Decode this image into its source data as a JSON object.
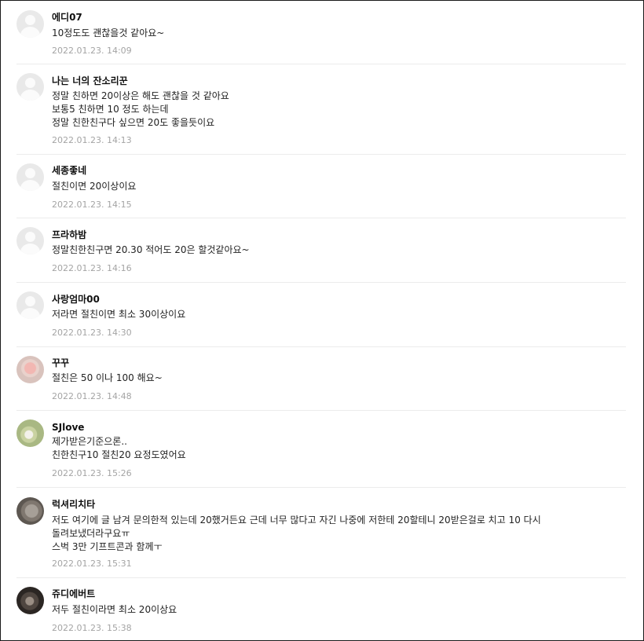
{
  "comments": [
    {
      "nickname": "에디07",
      "text": "10정도도 괜찮을것 같아요~",
      "date": "2022.01.23. 14:09",
      "avatar": "default-profile-icon"
    },
    {
      "nickname": "나는 너의 잔소리꾼",
      "text": "정말 친하면 20이상은 해도 괜찮을 것 같아요\n보통5 친하면 10 정도 하는데\n정말 친한친구다 싶으면 20도 좋을듯이요",
      "date": "2022.01.23. 14:13",
      "avatar": "default-profile-icon"
    },
    {
      "nickname": "세종좋네",
      "text": "절친이면 20이상이요",
      "date": "2022.01.23. 14:15",
      "avatar": "default-profile-icon"
    },
    {
      "nickname": "프라하밤",
      "text": "정말친한친구면 20.30 적어도 20은 할것같아요~",
      "date": "2022.01.23. 14:16",
      "avatar": "default-profile-icon"
    },
    {
      "nickname": "사랑엄마00",
      "text": "저라면 절친이면 최소 30이상이요",
      "date": "2022.01.23. 14:30",
      "avatar": "default-profile-icon"
    },
    {
      "nickname": "꾸꾸",
      "text": "절친은 50 이나 100 해요~",
      "date": "2022.01.23. 14:48",
      "avatar": "profile-photo"
    },
    {
      "nickname": "SJlove",
      "text": "제가받은기준으론..\n친한친구10 절친20 요정도였어요",
      "date": "2022.01.23. 15:26",
      "avatar": "profile-photo"
    },
    {
      "nickname": "럭셔리치타",
      "text": "저도 여기에 글 남겨 문의한적 있는데 20했거든요 근데 너무 많다고 자긴 나중에 저한테 20할테니 20받은걸로 치고 10 다시\n돌려보냈더라구요ㅠ\n스벅 3만 기프트콘과 함께ㅜ",
      "date": "2022.01.23. 15:31",
      "avatar": "profile-photo"
    },
    {
      "nickname": "쥬디에버트",
      "text": "저두 절친이라면 최소 20이상요",
      "date": "2022.01.23. 15:38",
      "avatar": "profile-photo"
    }
  ]
}
